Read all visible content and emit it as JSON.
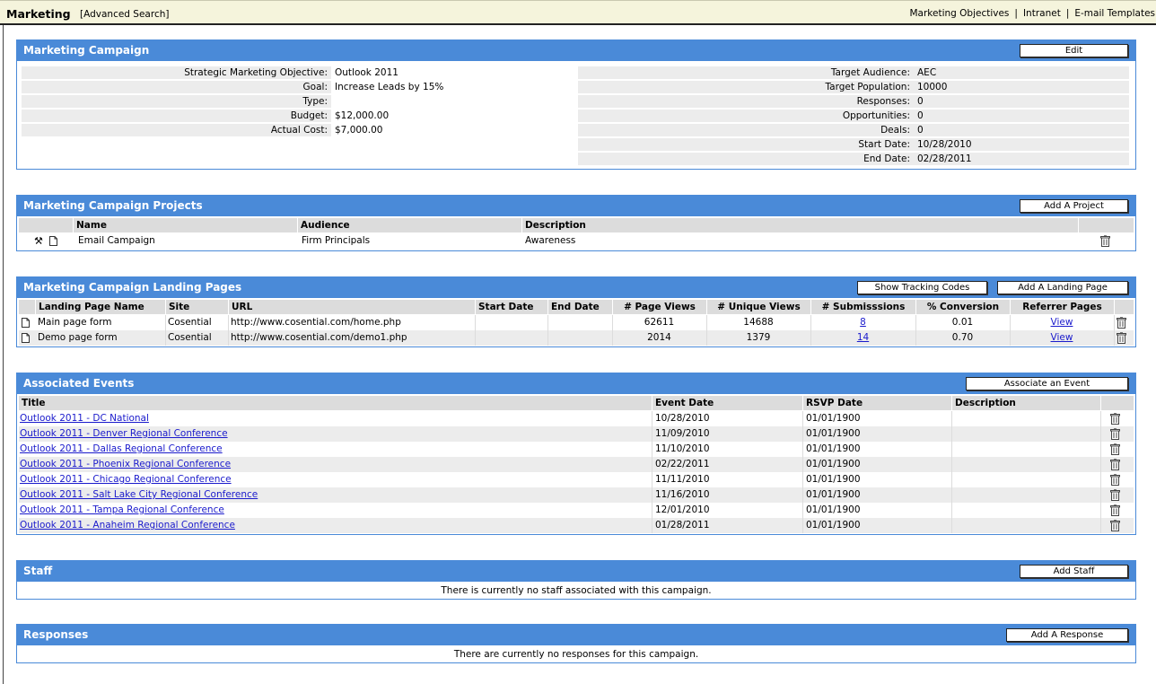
{
  "topbar": {
    "title": "Marketing",
    "advanced_search": "[Advanced Search]",
    "nav": [
      "Marketing Objectives",
      "Intranet",
      "E-mail Templates"
    ],
    "separator": "|"
  },
  "campaign": {
    "title": "Marketing Campaign",
    "edit_label": "Edit",
    "left_fields": [
      {
        "label": "Strategic Marketing Objective:",
        "value": "Outlook 2011"
      },
      {
        "label": "Goal:",
        "value": "Increase Leads by 15%"
      },
      {
        "label": "Type:",
        "value": ""
      },
      {
        "label": "Budget:",
        "value": "$12,000.00"
      },
      {
        "label": "Actual Cost:",
        "value": "$7,000.00"
      }
    ],
    "right_fields": [
      {
        "label": "Target Audience:",
        "value": "AEC"
      },
      {
        "label": "Target Population:",
        "value": "10000"
      },
      {
        "label": "Responses:",
        "value": "0"
      },
      {
        "label": "Opportunities:",
        "value": "0"
      },
      {
        "label": "Deals:",
        "value": "0"
      },
      {
        "label": "Start Date:",
        "value": "10/28/2010"
      },
      {
        "label": "End Date:",
        "value": "02/28/2011"
      }
    ]
  },
  "projects": {
    "title": "Marketing Campaign Projects",
    "add_label": "Add A Project",
    "columns": [
      "Name",
      "Audience",
      "Description"
    ],
    "rows": [
      {
        "name": "Email Campaign",
        "audience": "Firm Principals",
        "description": "Awareness"
      }
    ]
  },
  "landing": {
    "title": "Marketing Campaign Landing Pages",
    "show_codes_label": "Show Tracking Codes",
    "add_label": "Add A Landing Page",
    "columns": [
      "Landing Page Name",
      "Site",
      "URL",
      "Start Date",
      "End Date",
      "# Page Views",
      "# Unique Views",
      "# Submisssions",
      "% Conversion",
      "Referrer Pages"
    ],
    "rows": [
      {
        "name": "Main page form",
        "site": "Cosential",
        "url": "http://www.cosential.com/home.php",
        "start": "",
        "end": "",
        "page_views": "62611",
        "unique_views": "14688",
        "submissions": "8",
        "conversion": "0.01",
        "referrer": "View"
      },
      {
        "name": "Demo page form",
        "site": "Cosential",
        "url": "http://www.cosential.com/demo1.php",
        "start": "",
        "end": "",
        "page_views": "2014",
        "unique_views": "1379",
        "submissions": "14",
        "conversion": "0.70",
        "referrer": "View"
      }
    ]
  },
  "events": {
    "title": "Associated Events",
    "associate_label": "Associate an Event",
    "columns": [
      "Title",
      "Event Date",
      "RSVP Date",
      "Description"
    ],
    "rows": [
      {
        "title": "Outlook 2011 - DC National",
        "event_date": "10/28/2010",
        "rsvp": "01/01/1900"
      },
      {
        "title": "Outlook 2011 - Denver Regional Conference",
        "event_date": "11/09/2010",
        "rsvp": "01/01/1900"
      },
      {
        "title": "Outlook 2011 - Dallas Regional Conference",
        "event_date": "11/10/2010",
        "rsvp": "01/01/1900"
      },
      {
        "title": "Outlook 2011 - Phoenix Regional Conference",
        "event_date": "02/22/2011",
        "rsvp": "01/01/1900"
      },
      {
        "title": "Outlook 2011 - Chicago Regional Conference",
        "event_date": "11/11/2010",
        "rsvp": "01/01/1900"
      },
      {
        "title": "Outlook 2011 - Salt Lake City Regional Conference",
        "event_date": "11/16/2010",
        "rsvp": "01/01/1900"
      },
      {
        "title": "Outlook 2011 - Tampa Regional Conference",
        "event_date": "12/01/2010",
        "rsvp": "01/01/1900"
      },
      {
        "title": "Outlook 2011 - Anaheim Regional Conference",
        "event_date": "01/28/2011",
        "rsvp": "01/01/1900"
      }
    ]
  },
  "staff": {
    "title": "Staff",
    "add_label": "Add Staff",
    "empty_message": "There is currently no staff associated with this campaign."
  },
  "responses": {
    "title": "Responses",
    "add_label": "Add A Response",
    "empty_message": "There are currently no responses for this campaign."
  },
  "colors": {
    "accent": "#4a8ad8",
    "topbar": "#f5f4dc",
    "link": "#1a1acc",
    "row_alt": "#ececec"
  },
  "icons": [
    "tools-icon",
    "document-icon",
    "trash-icon"
  ]
}
